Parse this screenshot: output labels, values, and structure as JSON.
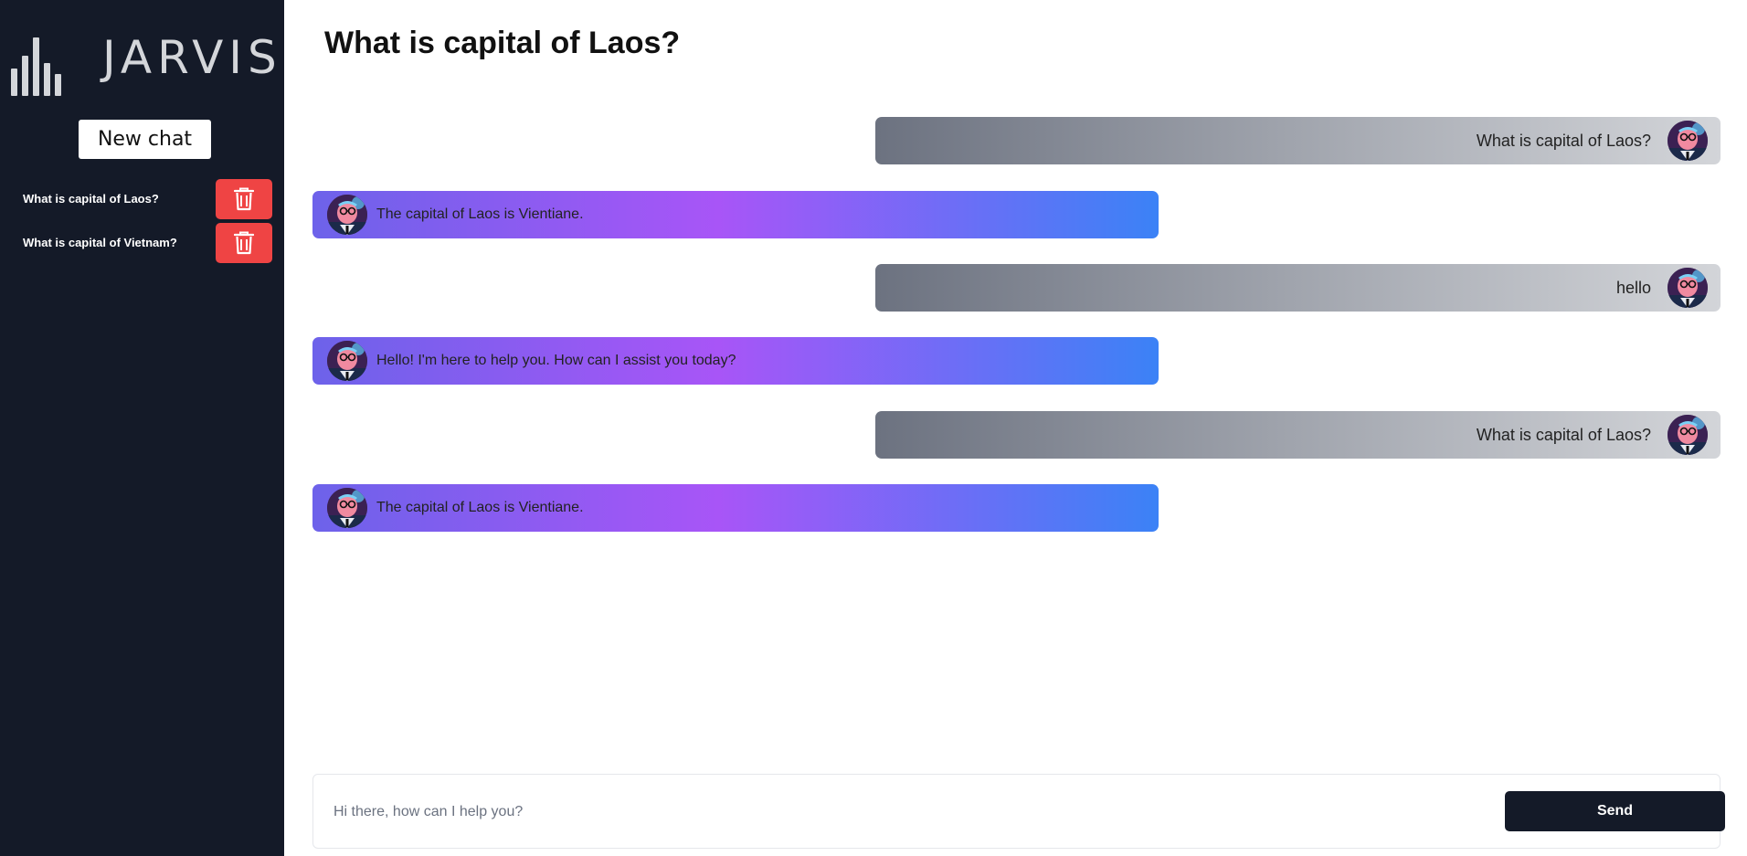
{
  "app": {
    "logo_text": "JARVIS"
  },
  "sidebar": {
    "new_chat_label": "New chat",
    "history": [
      {
        "label": "What is capital of Laos?"
      },
      {
        "label": "What is capital of Vietnam?"
      }
    ]
  },
  "main": {
    "title": "What is capital of Laos?",
    "messages": [
      {
        "role": "user",
        "text": "What is capital of Laos?"
      },
      {
        "role": "assistant",
        "text": "The capital of Laos is Vientiane."
      },
      {
        "role": "user",
        "text": "hello"
      },
      {
        "role": "assistant",
        "text": "Hello! I'm here to help you. How can I assist you today?"
      },
      {
        "role": "user",
        "text": "What is capital of Laos?"
      },
      {
        "role": "assistant",
        "text": "The capital of Laos is Vientiane."
      }
    ]
  },
  "composer": {
    "placeholder": "Hi there, how can I help you?",
    "send_label": "Send"
  },
  "colors": {
    "sidebar_bg": "#141a28",
    "delete_red": "#ef4444",
    "user_bubble": [
      "#6c7280",
      "#d3d5d9"
    ],
    "bot_bubble": [
      "#6d62ea",
      "#a855f7",
      "#3b82f6"
    ]
  },
  "icons": {
    "delete": "trash-icon",
    "logo": "sound-bars-icon",
    "avatar": "avatar"
  }
}
